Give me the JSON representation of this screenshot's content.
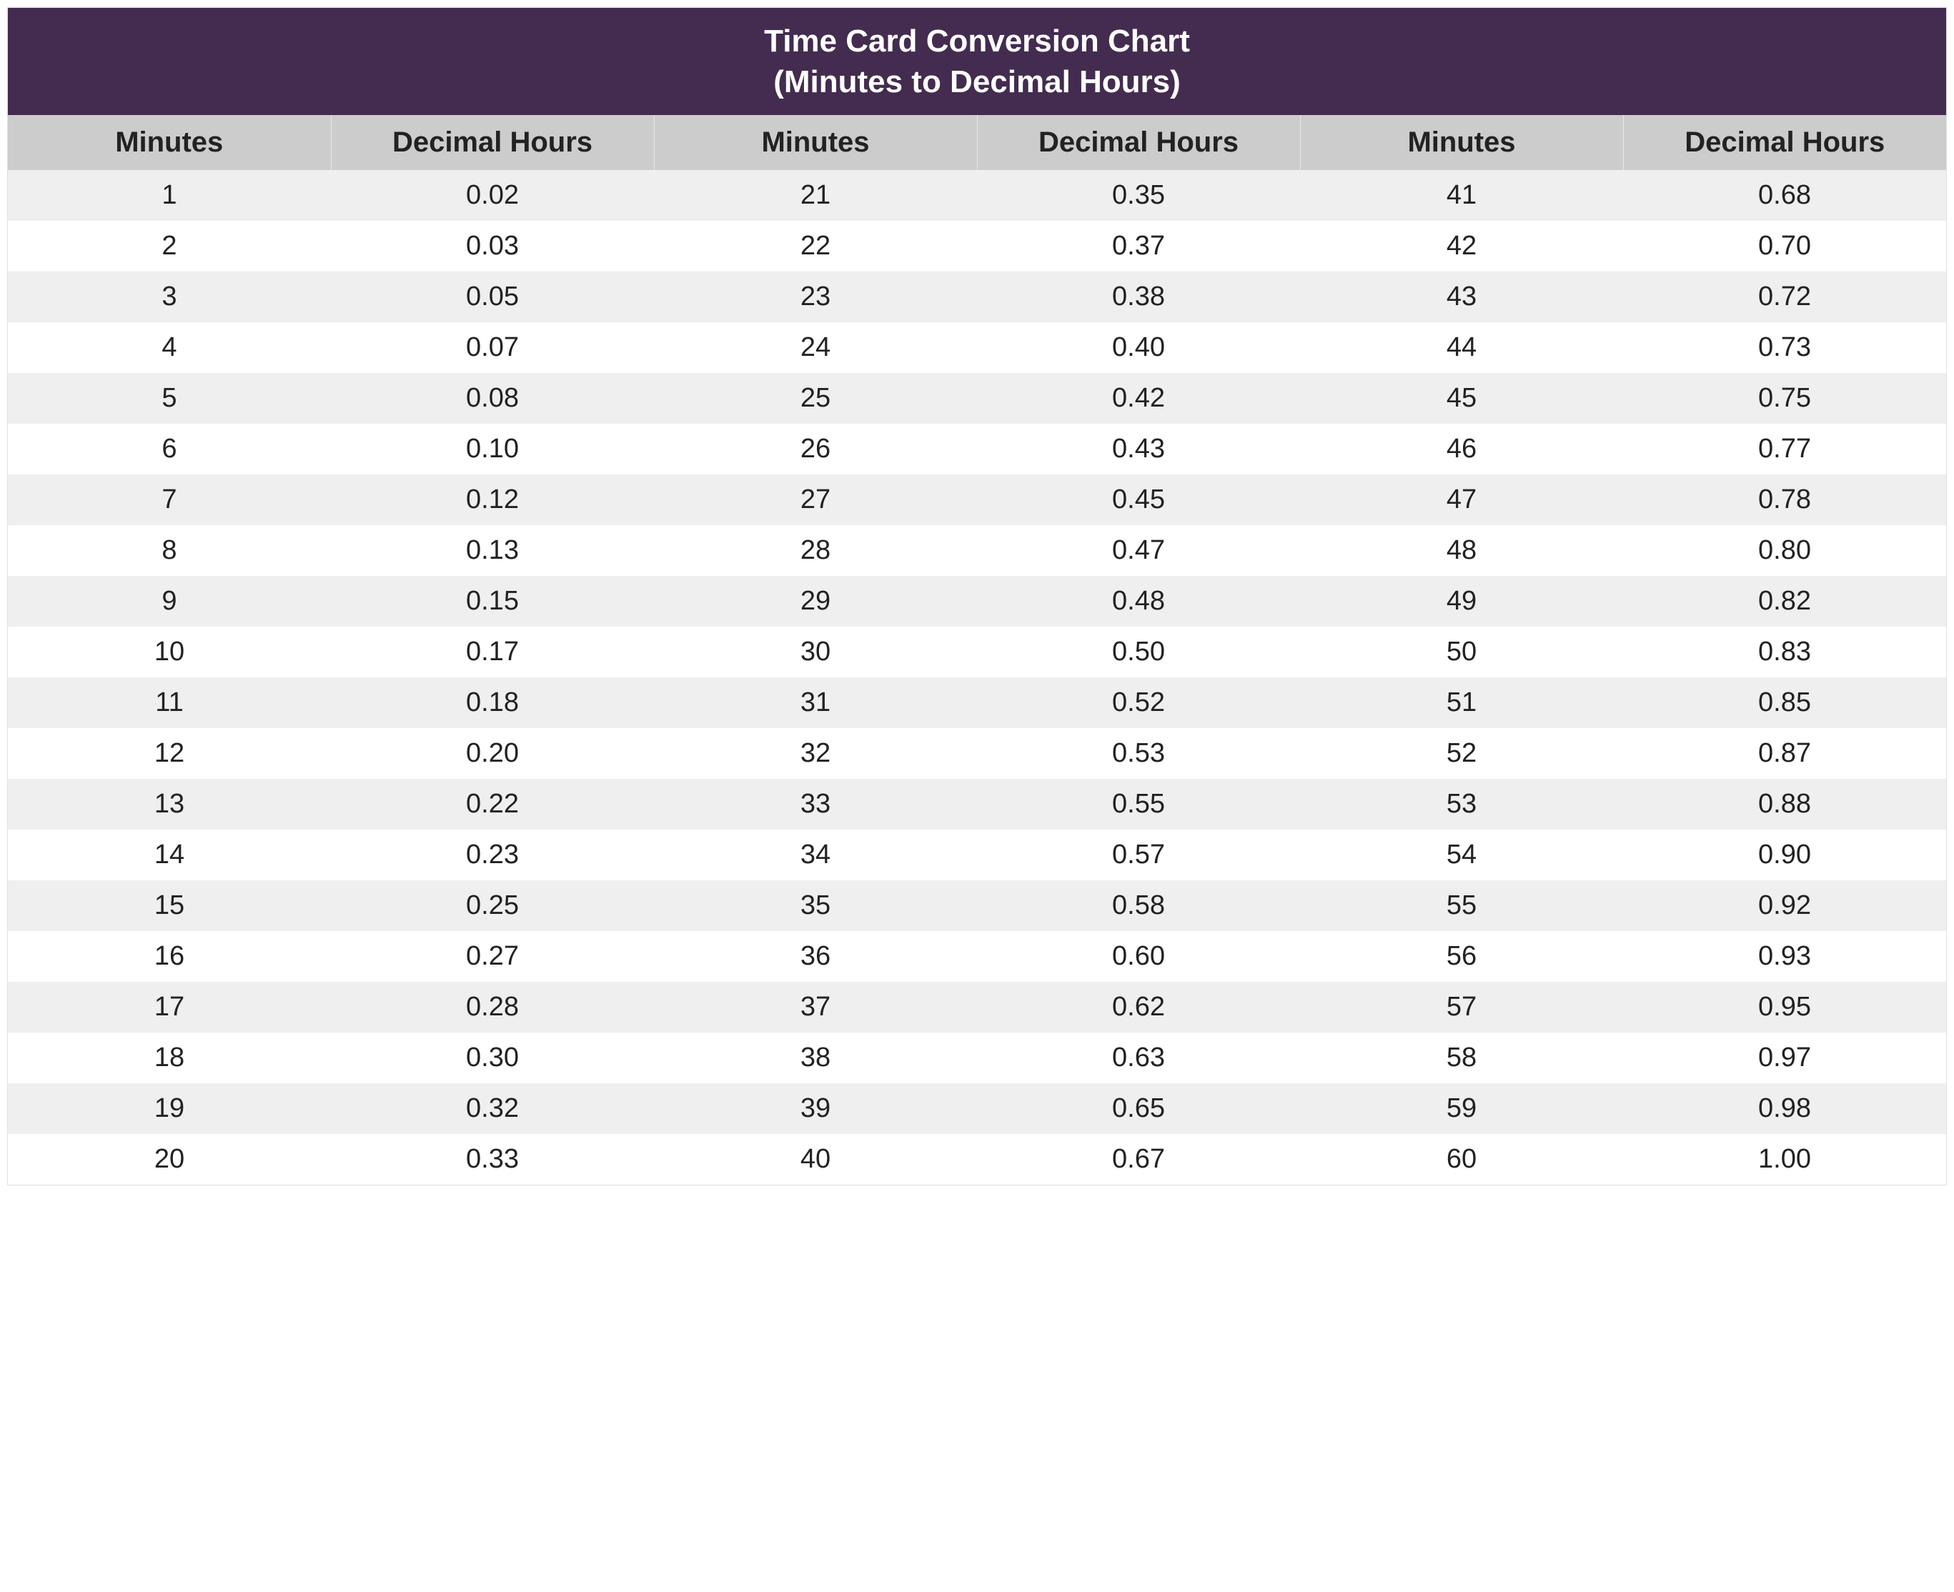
{
  "title_line1": "Time Card Conversion Chart",
  "title_line2": "(Minutes to Decimal Hours)",
  "headers": {
    "minutes": "Minutes",
    "decimal": "Decimal Hours"
  },
  "chart_data": {
    "type": "table",
    "title": "Time Card Conversion Chart (Minutes to Decimal Hours)",
    "columns": [
      "Minutes",
      "Decimal Hours",
      "Minutes",
      "Decimal Hours",
      "Minutes",
      "Decimal Hours"
    ],
    "rows": [
      {
        "m1": "1",
        "d1": "0.02",
        "m2": "21",
        "d2": "0.35",
        "m3": "41",
        "d3": "0.68"
      },
      {
        "m1": "2",
        "d1": "0.03",
        "m2": "22",
        "d2": "0.37",
        "m3": "42",
        "d3": "0.70"
      },
      {
        "m1": "3",
        "d1": "0.05",
        "m2": "23",
        "d2": "0.38",
        "m3": "43",
        "d3": "0.72"
      },
      {
        "m1": "4",
        "d1": "0.07",
        "m2": "24",
        "d2": "0.40",
        "m3": "44",
        "d3": "0.73"
      },
      {
        "m1": "5",
        "d1": "0.08",
        "m2": "25",
        "d2": "0.42",
        "m3": "45",
        "d3": "0.75"
      },
      {
        "m1": "6",
        "d1": "0.10",
        "m2": "26",
        "d2": "0.43",
        "m3": "46",
        "d3": "0.77"
      },
      {
        "m1": "7",
        "d1": "0.12",
        "m2": "27",
        "d2": "0.45",
        "m3": "47",
        "d3": "0.78"
      },
      {
        "m1": "8",
        "d1": "0.13",
        "m2": "28",
        "d2": "0.47",
        "m3": "48",
        "d3": "0.80"
      },
      {
        "m1": "9",
        "d1": "0.15",
        "m2": "29",
        "d2": "0.48",
        "m3": "49",
        "d3": "0.82"
      },
      {
        "m1": "10",
        "d1": "0.17",
        "m2": "30",
        "d2": "0.50",
        "m3": "50",
        "d3": "0.83"
      },
      {
        "m1": "11",
        "d1": "0.18",
        "m2": "31",
        "d2": "0.52",
        "m3": "51",
        "d3": "0.85"
      },
      {
        "m1": "12",
        "d1": "0.20",
        "m2": "32",
        "d2": "0.53",
        "m3": "52",
        "d3": "0.87"
      },
      {
        "m1": "13",
        "d1": "0.22",
        "m2": "33",
        "d2": "0.55",
        "m3": "53",
        "d3": "0.88"
      },
      {
        "m1": "14",
        "d1": "0.23",
        "m2": "34",
        "d2": "0.57",
        "m3": "54",
        "d3": "0.90"
      },
      {
        "m1": "15",
        "d1": "0.25",
        "m2": "35",
        "d2": "0.58",
        "m3": "55",
        "d3": "0.92"
      },
      {
        "m1": "16",
        "d1": "0.27",
        "m2": "36",
        "d2": "0.60",
        "m3": "56",
        "d3": "0.93"
      },
      {
        "m1": "17",
        "d1": "0.28",
        "m2": "37",
        "d2": "0.62",
        "m3": "57",
        "d3": "0.95"
      },
      {
        "m1": "18",
        "d1": "0.30",
        "m2": "38",
        "d2": "0.63",
        "m3": "58",
        "d3": "0.97"
      },
      {
        "m1": "19",
        "d1": "0.32",
        "m2": "39",
        "d2": "0.65",
        "m3": "59",
        "d3": "0.98"
      },
      {
        "m1": "20",
        "d1": "0.33",
        "m2": "40",
        "d2": "0.67",
        "m3": "60",
        "d3": "1.00"
      }
    ]
  }
}
